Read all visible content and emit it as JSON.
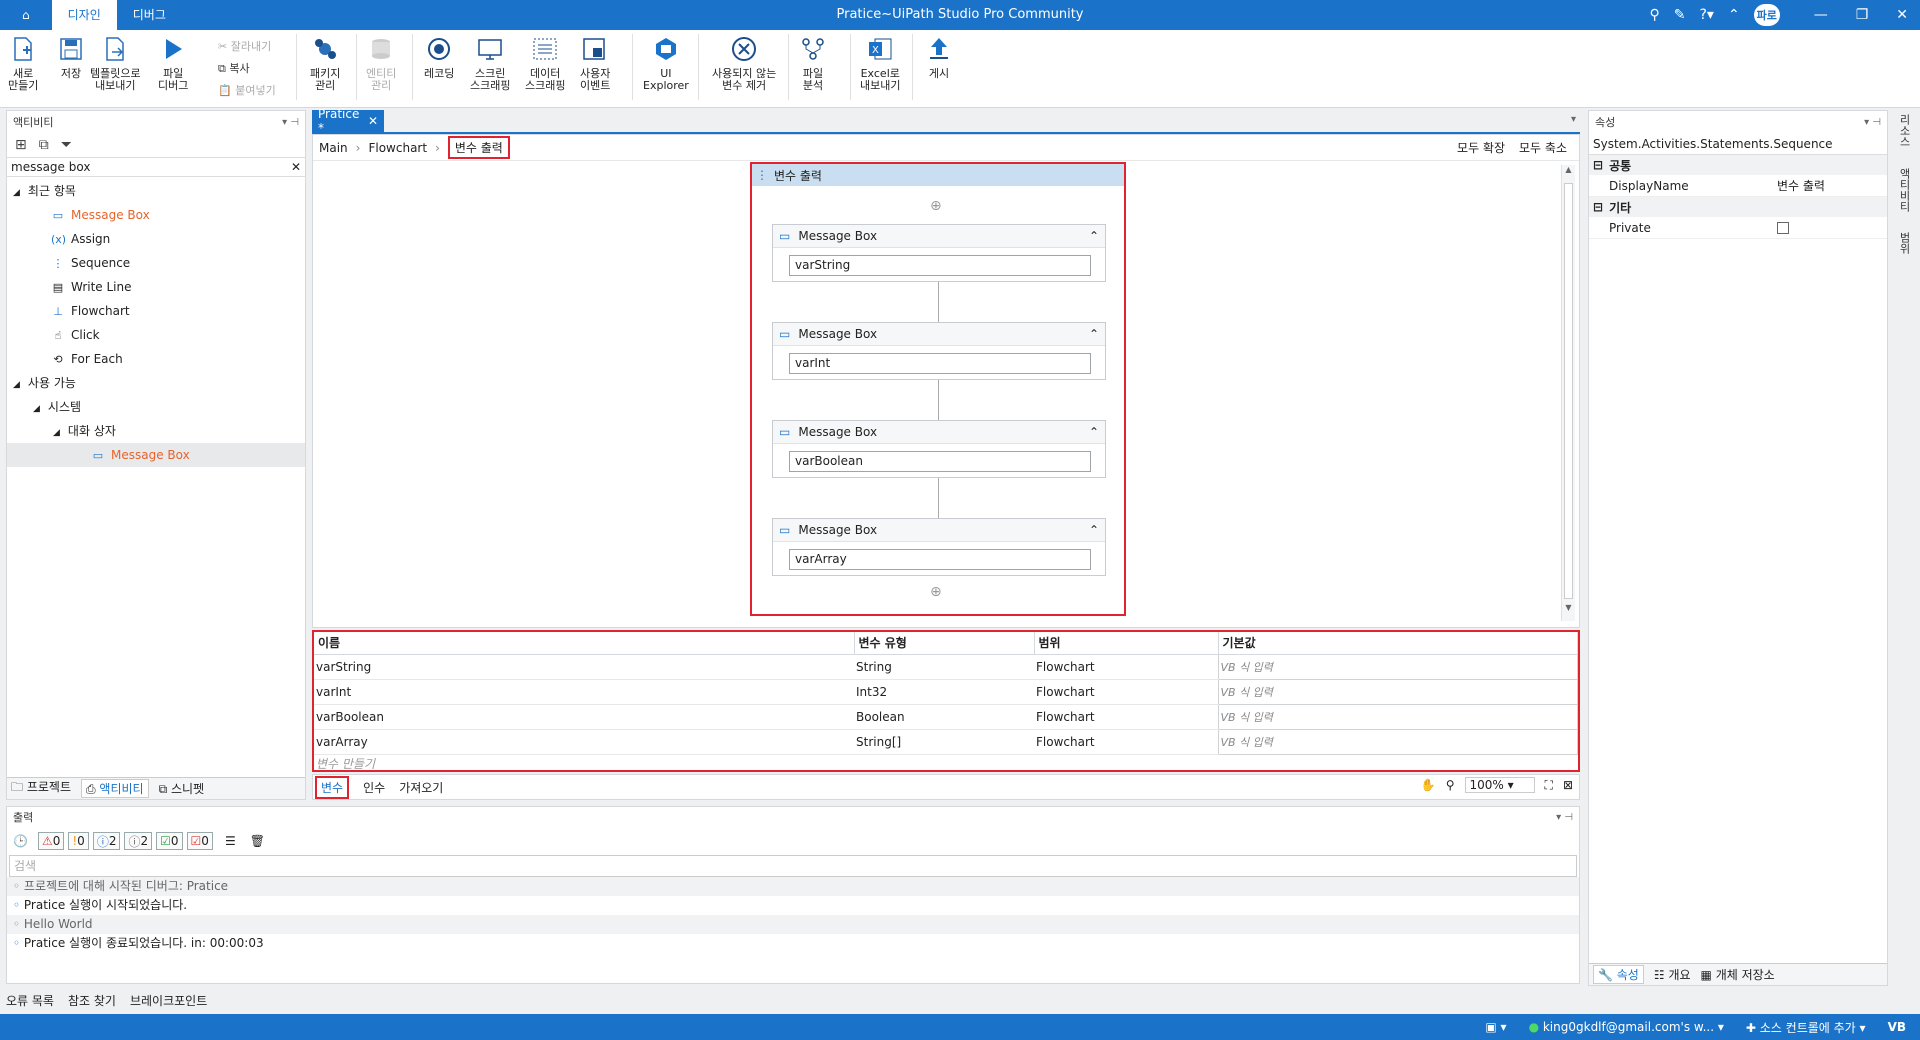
{
  "titlebar": {
    "home_icon": "home-icon",
    "tabs": [
      "디자인",
      "디버그"
    ],
    "title": "Pratice~UiPath Studio Pro Community",
    "user_initials": "파로"
  },
  "ribbon": {
    "new": "새로\n만들기",
    "save": "저장",
    "export_template": "템플릿으로\n내보내기",
    "debug_file": "파일\n디버그",
    "cut": "잘라내기",
    "copy": "복사",
    "paste": "붙여넣기",
    "manage_packages": "패키지\n관리",
    "manage_entities": "엔티티\n관리",
    "recording": "레코딩",
    "screen_scraping": "스크린\n스크래핑",
    "data_scraping": "데이터\n스크래핑",
    "user_events": "사용자\n이벤트",
    "ui_explorer": "UI\nExplorer",
    "remove_unused": "사용되지 않는\n변수 제거",
    "file_analysis": "파일\n분석",
    "export_excel": "Excel로\n내보내기",
    "publish": "게시"
  },
  "activities": {
    "header": "액티비티",
    "search_value": "message box",
    "recent_header": "최근 항목",
    "recent_items": [
      {
        "label": "Message Box",
        "icon": "message-box-icon"
      },
      {
        "label": "Assign",
        "icon": "assign-icon"
      },
      {
        "label": "Sequence",
        "icon": "sequence-icon"
      },
      {
        "label": "Write Line",
        "icon": "write-line-icon"
      },
      {
        "label": "Flowchart",
        "icon": "flowchart-icon"
      },
      {
        "label": "Click",
        "icon": "click-icon"
      },
      {
        "label": "For Each",
        "icon": "for-each-icon"
      }
    ],
    "available_header": "사용 가능",
    "system_header": "시스템",
    "dialog_header": "대화 상자",
    "dialog_item": "Message Box",
    "bottom_tabs": [
      "프로젝트",
      "액티비티",
      "스니펫"
    ]
  },
  "designer": {
    "doc_tab": "Pratice *",
    "breadcrumb": [
      "Main",
      "Flowchart",
      "변수 출력"
    ],
    "expand_all": "모두 확장",
    "collapse_all": "모두 축소",
    "sequence_title": "변수 출력",
    "message_boxes": [
      {
        "title": "Message Box",
        "value": "varString"
      },
      {
        "title": "Message Box",
        "value": "varInt"
      },
      {
        "title": "Message Box",
        "value": "varBoolean"
      },
      {
        "title": "Message Box",
        "value": "varArray"
      }
    ]
  },
  "variables": {
    "headers": [
      "이름",
      "변수 유형",
      "범위",
      "기본값"
    ],
    "rows": [
      {
        "name": "varString",
        "type": "String",
        "scope": "Flowchart",
        "default": "VB 식 입력"
      },
      {
        "name": "varInt",
        "type": "Int32",
        "scope": "Flowchart",
        "default": "VB 식 입력"
      },
      {
        "name": "varBoolean",
        "type": "Boolean",
        "scope": "Flowchart",
        "default": "VB 식 입력"
      },
      {
        "name": "varArray",
        "type": "String[]",
        "scope": "Flowchart",
        "default": "VB 식 입력"
      }
    ],
    "create": "변수 만들기",
    "bottom_tabs": [
      "변수",
      "인수",
      "가져오기"
    ],
    "zoom": "100%"
  },
  "output": {
    "header": "출력",
    "counts": [
      {
        "icon": "error-icon",
        "value": "0",
        "color": "#d83b3b"
      },
      {
        "icon": "warning-icon",
        "value": "0",
        "color": "#e89a1a"
      },
      {
        "icon": "info-icon",
        "value": "2",
        "color": "#2f6fc9"
      },
      {
        "icon": "trace-icon",
        "value": "2",
        "color": "#666666"
      },
      {
        "icon": "success-icon",
        "value": "0",
        "color": "#2ea043"
      },
      {
        "icon": "verbose-icon",
        "value": "0",
        "color": "#d83b3b"
      }
    ],
    "search_placeholder": "검색",
    "lines": [
      {
        "text": "프로젝트에 대해 시작된 디버그: Pratice",
        "bold": false
      },
      {
        "text": "Pratice 실행이 시작되었습니다.",
        "bold": true
      },
      {
        "text": "Hello World",
        "bold": false
      },
      {
        "text": "Pratice 실행이 종료되었습니다. in: 00:00:03",
        "bold": true
      }
    ],
    "bottom_tabs": [
      "오류 목록",
      "참조 찾기",
      "브레이크포인트"
    ]
  },
  "properties": {
    "header": "속성",
    "type_name": "System.Activities.Statements.Sequence",
    "common_header": "공통",
    "display_name_label": "DisplayName",
    "display_name_value": "변수 출력",
    "misc_header": "기타",
    "private_label": "Private",
    "bottom_tabs": [
      "속성",
      "개요",
      "개체 저장소"
    ]
  },
  "right_strip": [
    "리소스",
    "액티비티",
    "범위"
  ],
  "statusbar": {
    "account": "king0gkdlf@gmail.com's w...",
    "source_control": "소스 컨트롤에 추가",
    "language": "VB"
  }
}
